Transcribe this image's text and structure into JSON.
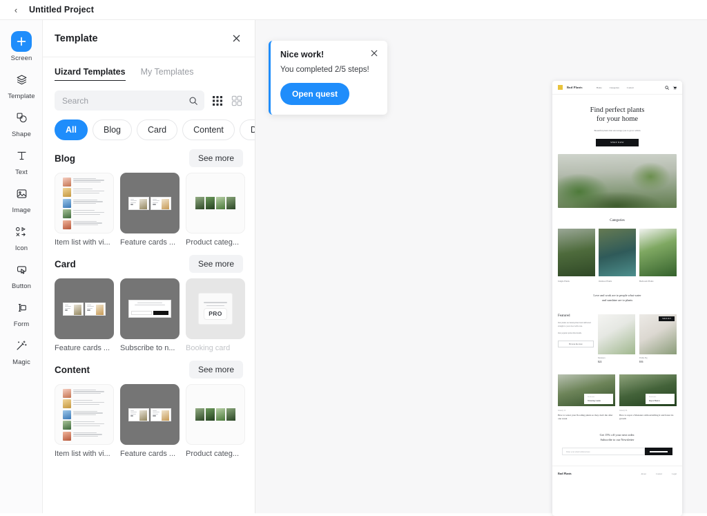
{
  "topbar": {
    "back_icon": "chevron-left-icon",
    "project_title": "Untitled Project"
  },
  "rail": {
    "items": [
      {
        "label": "Screen",
        "icon": "plus-icon",
        "active": true
      },
      {
        "label": "Template",
        "icon": "layers-icon",
        "active": false
      },
      {
        "label": "Shape",
        "icon": "shapes-icon",
        "active": false
      },
      {
        "label": "Text",
        "icon": "text-icon",
        "active": false
      },
      {
        "label": "Image",
        "icon": "image-icon",
        "active": false
      },
      {
        "label": "Icon",
        "icon": "icon-set-icon",
        "active": false
      },
      {
        "label": "Button",
        "icon": "button-icon",
        "active": false
      },
      {
        "label": "Form",
        "icon": "form-icon",
        "active": false
      },
      {
        "label": "Magic",
        "icon": "magic-wand-icon",
        "active": false
      }
    ]
  },
  "panel": {
    "title": "Template",
    "close_icon": "close-icon",
    "tabs": [
      {
        "label": "Uizard Templates",
        "selected": true
      },
      {
        "label": "My Templates",
        "selected": false
      }
    ],
    "search": {
      "placeholder": "Search",
      "value": "",
      "icon": "search-icon"
    },
    "view_toggles": [
      {
        "name": "grid-3x3-view-toggle",
        "active": true
      },
      {
        "name": "grid-2x2-view-toggle",
        "active": false
      }
    ],
    "chips": [
      {
        "label": "All",
        "selected": true
      },
      {
        "label": "Blog",
        "selected": false
      },
      {
        "label": "Card",
        "selected": false
      },
      {
        "label": "Content",
        "selected": false
      },
      {
        "label": "Dialog",
        "selected": false
      }
    ],
    "see_more_label": "See more",
    "sections": [
      {
        "title": "Blog",
        "cards": [
          {
            "name": "Item list with vi...",
            "style": "light",
            "preview": "item-list",
            "locked": false
          },
          {
            "name": "Feature cards ...",
            "style": "dark",
            "preview": "two-cards",
            "locked": false
          },
          {
            "name": "Product categ...",
            "style": "light",
            "preview": "four-images",
            "locked": false
          }
        ]
      },
      {
        "title": "Card",
        "cards": [
          {
            "name": "Feature cards ...",
            "style": "dark",
            "preview": "two-cards",
            "locked": false
          },
          {
            "name": "Subscribe to n...",
            "style": "dark",
            "preview": "dialog",
            "locked": false
          },
          {
            "name": "Booking card",
            "style": "pro",
            "preview": "pro",
            "locked": true,
            "badge": "PRO"
          }
        ]
      },
      {
        "title": "Content",
        "cards": [
          {
            "name": "Item list with vi...",
            "style": "light",
            "preview": "item-list",
            "locked": false
          },
          {
            "name": "Feature cards ...",
            "style": "dark",
            "preview": "two-cards",
            "locked": false
          },
          {
            "name": "Product categ...",
            "style": "light",
            "preview": "four-images",
            "locked": false
          }
        ]
      }
    ]
  },
  "toast": {
    "title": "Nice work!",
    "message": "You completed 2/5 steps!",
    "button_label": "Open quest",
    "close_icon": "close-icon",
    "accent_color": "#1f8dfb"
  },
  "artboard": {
    "nav": {
      "brand": "Bud Plants",
      "links": [
        "Home",
        "Categories",
        "Contact"
      ],
      "icons": [
        "search-icon",
        "cart-icon"
      ]
    },
    "hero": {
      "headline_line1": "Find perfect plants",
      "headline_line2": "for your home",
      "subtext": "Beautiful plants that encourage you to grow within",
      "cta_label": "SHOP NOW"
    },
    "categories": {
      "title": "Categories",
      "items": [
        {
          "label": "Jungle Plants"
        },
        {
          "label": "Outdoor Plants"
        },
        {
          "label": "Bedroom Plants"
        }
      ]
    },
    "quote_line1": "Love and work are to people what water",
    "quote_line2": "and sunshine are to plants",
    "featured": {
      "title": "Featured",
      "paragraph1": "Our plants are hand-picked and delivered straight to your door with care.",
      "paragraph2": "Our popular picks this month.",
      "button_label": "Browse the store",
      "products": [
        {
          "name": "Monstera",
          "price": "$24",
          "tag": ""
        },
        {
          "name": "Fiddle Fig",
          "price": "$36",
          "tag": "SOLD OUT"
        }
      ]
    },
    "blog": {
      "posts": [
        {
          "date": "January 12",
          "title": "How to water your flooding plants so they don't die after one week",
          "card_sub": "Read more",
          "card_title": "Watering Guide"
        },
        {
          "date": "January 04",
          "title": "How to repot a Monstera without killing it and foster its growth",
          "card_sub": "Read more",
          "card_title": "Repot Basics"
        }
      ]
    },
    "newsletter": {
      "line1": "Get 15% off your next order.",
      "line2": "Subscribe to our Newsletter",
      "placeholder": "Enter your email address here",
      "button_label": "SUBSCRIBE"
    },
    "footer": {
      "brand": "Bud Plants",
      "links": [
        "About",
        "Contact",
        "Legal"
      ]
    }
  }
}
